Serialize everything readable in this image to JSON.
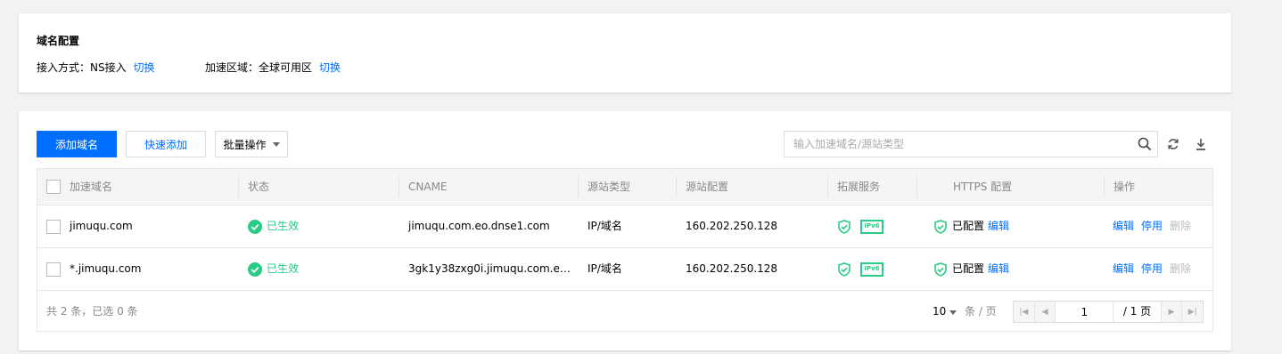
{
  "config": {
    "title": "域名配置",
    "access_label": "接入方式：",
    "access_value": "NS接入",
    "access_switch": "切换",
    "region_label": "加速区域：",
    "region_value": "全球可用区",
    "region_switch": "切换"
  },
  "toolbar": {
    "add_domain": "添加域名",
    "quick_add": "快速添加",
    "batch_ops": "批量操作"
  },
  "search": {
    "placeholder": "输入加速域名/源站类型"
  },
  "table": {
    "headers": [
      "加速域名",
      "状态",
      "CNAME",
      "源站类型",
      "源站配置",
      "拓展服务",
      "HTTPS 配置",
      "操作"
    ],
    "rows": [
      {
        "domain": "jimuqu.com",
        "status": "已生效",
        "cname": "jimuqu.com.eo.dnse1.com",
        "origin_type": "IP/域名",
        "origin_config": "160.202.250.128",
        "ipv6_badge": "IPv6",
        "https_status": "已配置",
        "https_edit": "编辑",
        "op_edit": "编辑",
        "op_disable": "停用",
        "op_delete": "删除"
      },
      {
        "domain": "*.jimuqu.com",
        "status": "已生效",
        "cname": "3gk1y38zxg0i.jimuqu.com.eo.d...",
        "origin_type": "IP/域名",
        "origin_config": "160.202.250.128",
        "ipv6_badge": "IPv6",
        "https_status": "已配置",
        "https_edit": "编辑",
        "op_edit": "编辑",
        "op_disable": "停用",
        "op_delete": "删除"
      }
    ]
  },
  "footer": {
    "summary": "共 2 条，已选 0 条",
    "page_size": "10",
    "per_page": "条 / 页",
    "current_page": "1",
    "total_pages": "/ 1 页"
  },
  "colors": {
    "primary": "#006eff",
    "success": "#29cc85"
  },
  "icons": {
    "search": "search-icon",
    "refresh": "refresh-icon",
    "download": "download-icon",
    "status_ok": "check-circle-icon",
    "shield": "shield-check-icon"
  }
}
